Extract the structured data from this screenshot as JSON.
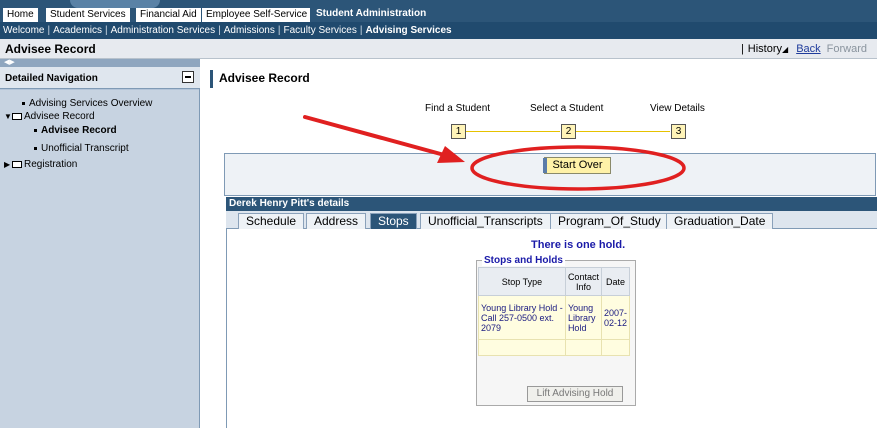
{
  "top_tabs": [
    {
      "label": "Home"
    },
    {
      "label": "Student Services"
    },
    {
      "label": "Financial Aid"
    },
    {
      "label": "Employee Self-Service"
    },
    {
      "label": "Student Administration"
    }
  ],
  "sub_nav": [
    "Welcome",
    "Academics",
    "Administration Services",
    "Admissions",
    "Faculty Services",
    "Advising Services"
  ],
  "page": {
    "title": "Advisee Record",
    "history_label": "History",
    "back_label": "Back",
    "forward_label": "Forward"
  },
  "left_nav": {
    "header": "Detailed Navigation",
    "items": [
      {
        "label": "Advising Services Overview"
      },
      {
        "label": "Advisee Record"
      },
      {
        "label": "Advisee Record"
      },
      {
        "label": "Unofficial Transcript"
      },
      {
        "label": "Registration"
      }
    ]
  },
  "main": {
    "title": "Advisee Record",
    "steps": [
      {
        "label": "Find a Student",
        "num": "1"
      },
      {
        "label": "Select a Student",
        "num": "2"
      },
      {
        "label": "View Details",
        "num": "3"
      }
    ],
    "start_over": "Start Over",
    "details_title": "Derek Henry Pitt's details",
    "tabs": [
      {
        "label": "Schedule"
      },
      {
        "label": "Address"
      },
      {
        "label": "Stops"
      },
      {
        "label": "Unofficial_Transcripts"
      },
      {
        "label": "Program_Of_Study"
      },
      {
        "label": "Graduation_Date"
      }
    ],
    "hold_message": "There is one hold.",
    "holds_legend": "Stops and Holds",
    "holds_table": {
      "headers": [
        "Stop Type",
        "Contact Info",
        "Date"
      ],
      "rows": [
        [
          "Young Library Hold - Call 257-0500 ext. 2079",
          "Young Library Hold",
          "2007-02-12"
        ]
      ]
    },
    "lift_button": "Lift Advising Hold"
  },
  "colors": {
    "nav_blue": "#2c5578",
    "annotation_red": "#e02020",
    "button_yellow": "#fff2a8"
  }
}
